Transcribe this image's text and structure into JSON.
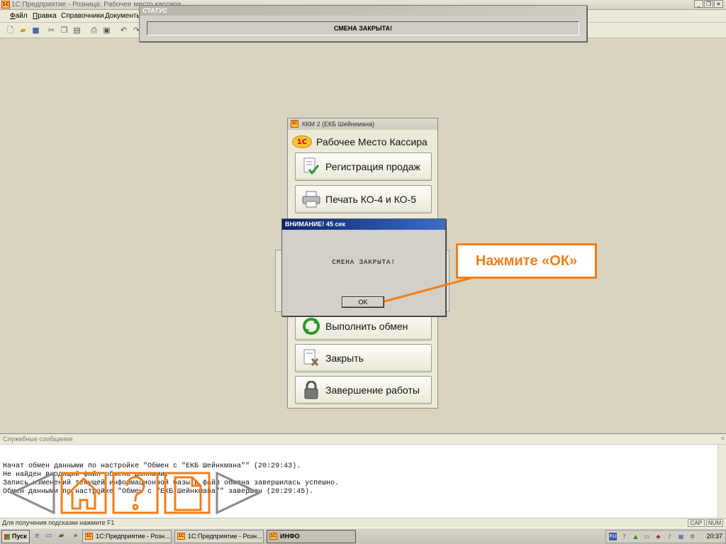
{
  "window": {
    "title": "1С:Предприятие - Розница: Рабочее место кассира",
    "icon": "1c-app-icon",
    "controls": [
      "_",
      "❐",
      "×"
    ]
  },
  "menu": [
    {
      "label": "Файл"
    },
    {
      "label": "Правка"
    },
    {
      "label": "Справочники"
    },
    {
      "label": "Документы"
    }
  ],
  "status_window": {
    "caption": "СТАТУС",
    "message": "СМЕНА ЗАКРЫТА!"
  },
  "kkm": {
    "caption": "ККМ 2  (ЕКБ Шейнкмана)",
    "header": "Рабочее Место Кассира",
    "logo": "1С",
    "buttons": [
      {
        "label": "Регистрация продаж",
        "icon": "document-check-icon"
      },
      {
        "label": "Печать КО-4 и КО-5",
        "icon": "printer-icon"
      },
      {
        "label": "Выполнить обмен",
        "icon": "refresh-icon"
      },
      {
        "label": "Закрыть",
        "icon": "document-close-icon"
      },
      {
        "label": "Завершение работы",
        "icon": "lock-icon"
      }
    ]
  },
  "dialog": {
    "caption": "ВНИМАНИЕ! 45 сек",
    "message": "СМЕНА ЗАКРЫТА!",
    "ok_label": "OK"
  },
  "callout": {
    "text": "Нажмите «ОК»",
    "color": "#f07f1a"
  },
  "messages": {
    "caption": "Служебные сообщения",
    "lines": [
      "Начат обмен данными по настройке \"Обмен с \"ЕКБ Шейнкмана\"\" (20:29:43).",
      "Не найден входящий файл обмена данными.",
      "Запись изменений текущей информационной базы в файл обмена завершилась успешно.",
      "Обмен данными по настройке \"Обмен с \"ЕКБ Шейнкмана\"\" завершен (20:29:45)."
    ]
  },
  "nav": {
    "color": "#f07f1a",
    "icons": [
      "back-arrow-icon",
      "home-icon",
      "help-icon",
      "document-icon",
      "forward-arrow-icon"
    ]
  },
  "statusbar": {
    "hint": "Для получения подсказки нажмите F1",
    "indicators": [
      "CAP",
      "NUM"
    ]
  },
  "taskbar": {
    "start": "Пуск",
    "tasks": [
      {
        "label": "1С:Предприятие - Розн...",
        "active": false
      },
      {
        "label": "1С:Предприятие - Розн...",
        "active": false
      },
      {
        "label": "ИНФО",
        "active": true
      }
    ],
    "lang": "RU",
    "clock": "20:37"
  }
}
